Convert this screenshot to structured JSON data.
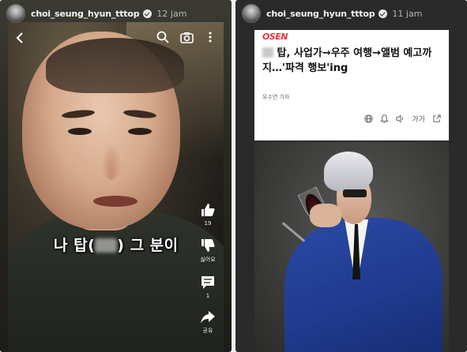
{
  "left_story": {
    "username": "choi_seung_hyun_tttop",
    "time": "12 jam",
    "subtitle_before": "나 탑(",
    "subtitle_after": ") 그 분이",
    "actions": {
      "like_count": "19",
      "dislike_label": "싫어요",
      "comment_count": "1",
      "share_label": "공유"
    }
  },
  "right_story": {
    "username": "choi_seung_hyun_tttop",
    "time": "11 jam",
    "article": {
      "brand": "OSEN",
      "headline_prefix": "",
      "headline_main": " 탑, 사업가→우주 여행→앨범 예고까지…'파격 행보'ing",
      "reporter": "유수연 기자",
      "font_size_label": "가가"
    }
  },
  "icons": {
    "back": "back-arrow-icon",
    "search": "search-icon",
    "camera": "camera-icon",
    "more": "more-vertical-icon",
    "like": "thumbs-up-icon",
    "dislike": "thumbs-down-icon",
    "comment": "comment-icon",
    "share": "share-icon",
    "globe": "globe-icon",
    "bell": "bell-icon",
    "speaker": "speaker-icon",
    "share_article": "share-icon"
  }
}
